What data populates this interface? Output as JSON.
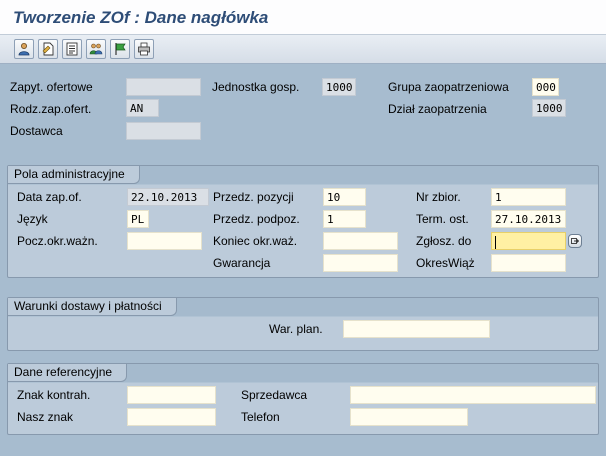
{
  "window": {
    "title": "Tworzenie ZOf : Dane nagłówka"
  },
  "toolbar": {
    "buttons": [
      {
        "icon": "person-icon"
      },
      {
        "icon": "document-icon"
      },
      {
        "icon": "text-icon"
      },
      {
        "icon": "partner-icon"
      },
      {
        "icon": "flag-icon"
      },
      {
        "icon": "print-icon"
      }
    ]
  },
  "header": {
    "rfq": {
      "label": "Zapyt. ofertowe",
      "value": ""
    },
    "rfq_type": {
      "label": "Rodz.zap.ofert.",
      "value": "AN"
    },
    "vendor": {
      "label": "Dostawca",
      "value": ""
    },
    "company_code": {
      "label": "Jednostka gosp.",
      "value": "1000"
    },
    "purch_group": {
      "label": "Grupa zaopatrzeniowa",
      "value": "000"
    },
    "purch_org": {
      "label": "Dział zaopatrzenia",
      "value": "1000"
    }
  },
  "admin": {
    "title": "Pola administracyjne",
    "rfq_date": {
      "label": "Data zap.of.",
      "value": "22.10.2013"
    },
    "language": {
      "label": "Język",
      "value": "PL"
    },
    "validity_start": {
      "label": "Pocz.okr.ważn.",
      "value": ""
    },
    "item_interval": {
      "label": "Przedz. pozycji",
      "value": "10"
    },
    "subitem_interval": {
      "label": "Przedz. podpoz.",
      "value": "1"
    },
    "validity_end": {
      "label": "Koniec okr.waż.",
      "value": ""
    },
    "warranty": {
      "label": "Gwarancja",
      "value": ""
    },
    "coll_no": {
      "label": "Nr zbior.",
      "value": "1"
    },
    "deadline": {
      "label": "Term. ost.",
      "value": "27.10.2013"
    },
    "apply_by": {
      "label": "Zgłosz. do",
      "value": ""
    },
    "binding_period": {
      "label": "OkresWiąż",
      "value": ""
    }
  },
  "delivery": {
    "title": "Warunki dostawy i płatności",
    "planned_terms": {
      "label": "War. plan.",
      "value": ""
    }
  },
  "reference": {
    "title": "Dane referencyjne",
    "your_ref": {
      "label": "Znak kontrah.",
      "value": ""
    },
    "our_ref": {
      "label": "Nasz znak",
      "value": ""
    },
    "salesperson": {
      "label": "Sprzedawca",
      "value": ""
    },
    "phone": {
      "label": "Telefon",
      "value": ""
    }
  }
}
